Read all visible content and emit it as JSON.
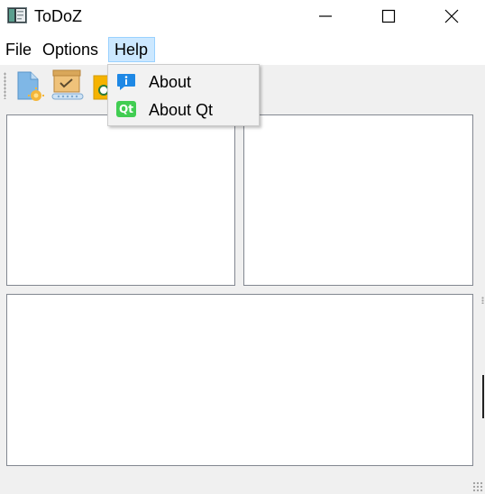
{
  "window": {
    "title": "ToDoZ",
    "controls": {
      "minimize_icon": "minimize-icon",
      "maximize_icon": "maximize-icon",
      "close_icon": "close-icon"
    }
  },
  "menubar": {
    "items": [
      {
        "label": "File"
      },
      {
        "label": "Options"
      },
      {
        "label": "Help",
        "open": true
      }
    ]
  },
  "toolbar": {
    "buttons": [
      {
        "icon": "new-document-icon"
      },
      {
        "icon": "tasks-box-icon"
      },
      {
        "icon": "folder-clock-icon"
      }
    ]
  },
  "help_menu": {
    "items": [
      {
        "label": "About",
        "icon": "info-icon"
      },
      {
        "label": "About Qt",
        "icon": "qt-logo-icon",
        "badge_text": "Qt"
      }
    ]
  },
  "colors": {
    "menu_highlight": "#cce8ff",
    "menu_highlight_border": "#99d1ff",
    "about_icon": "#1e88e5",
    "qt_green": "#41cd52"
  }
}
